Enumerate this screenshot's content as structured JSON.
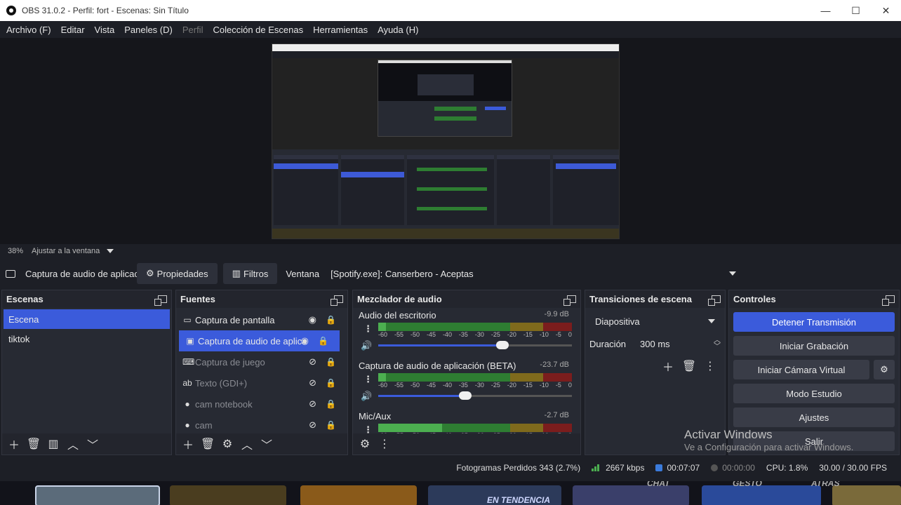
{
  "window": {
    "title": "OBS 31.0.2 - Perfil: fort - Escenas: Sin Título",
    "controls": [
      "—",
      "☐",
      "✕"
    ]
  },
  "menu": {
    "items": [
      {
        "label": "Archivo (F)",
        "disabled": false
      },
      {
        "label": "Editar",
        "disabled": false
      },
      {
        "label": "Vista",
        "disabled": false
      },
      {
        "label": "Paneles (D)",
        "disabled": false
      },
      {
        "label": "Perfil",
        "disabled": true
      },
      {
        "label": "Colección de Escenas",
        "disabled": false
      },
      {
        "label": "Herramientas",
        "disabled": false
      },
      {
        "label": "Ayuda (H)",
        "disabled": false
      }
    ]
  },
  "preview": {
    "zoom": "38%",
    "fit_label": "Ajustar a la ventana"
  },
  "source_toolbar": {
    "source_name": "Captura de audio de aplicación",
    "properties_label": "Propiedades",
    "filters_label": "Filtros",
    "window_label": "Ventana",
    "window_value": "[Spotify.exe]: Canserbero - Aceptas"
  },
  "scenes": {
    "title": "Escenas",
    "items": [
      {
        "label": "Escena",
        "selected": true
      },
      {
        "label": "tiktok",
        "selected": false
      }
    ]
  },
  "sources": {
    "title": "Fuentes",
    "items": [
      {
        "label": "Captura de pantalla",
        "icon": "monitor-icon",
        "visible": true,
        "selected": false
      },
      {
        "label": "Captura de audio de aplicación",
        "icon": "app-audio-icon",
        "visible": true,
        "selected": true
      },
      {
        "label": "Captura de juego",
        "icon": "gamepad-icon",
        "visible": false,
        "selected": false
      },
      {
        "label": "Texto (GDI+)",
        "icon": "text-icon",
        "visible": false,
        "selected": false
      },
      {
        "label": "cam notebook",
        "icon": "camera-icon",
        "visible": false,
        "selected": false
      },
      {
        "label": "cam",
        "icon": "camera-icon",
        "visible": false,
        "selected": false
      }
    ]
  },
  "mixer": {
    "title": "Mezclador de audio",
    "ticks": [
      "-60",
      "-55",
      "-50",
      "-45",
      "-40",
      "-35",
      "-30",
      "-25",
      "-20",
      "-15",
      "-10",
      "-5",
      "0"
    ],
    "channels": [
      {
        "name": "Audio del escritorio",
        "db": "-9.9 dB",
        "level": 0.04,
        "volume": 0.64
      },
      {
        "name": "Captura de audio de aplicación (BETA)",
        "db": "-23.7 dB",
        "level": 0.04,
        "volume": 0.45
      },
      {
        "name": "Mic/Aux",
        "db": "-2.7 dB",
        "level": 0.33,
        "volume": null
      }
    ]
  },
  "transitions": {
    "title": "Transiciones de escena",
    "selected": "Diapositiva",
    "duration_label": "Duración",
    "duration_value": "300 ms"
  },
  "controls": {
    "title": "Controles",
    "buttons": {
      "stop_stream": "Detener Transmisión",
      "start_record": "Iniciar Grabación",
      "virtual_cam": "Iniciar Cámara Virtual",
      "studio_mode": "Modo Estudio",
      "settings": "Ajustes",
      "exit": "Salir"
    }
  },
  "status": {
    "dropped_frames": "Fotogramas Perdidos 343 (2.7%)",
    "bitrate": "2667 kbps",
    "stream_time": "00:07:07",
    "record_time": "00:00:00",
    "cpu": "CPU: 1.8%",
    "fps": "30.00 / 30.00 FPS"
  },
  "watermark": {
    "line1": "Activar Windows",
    "line2": "Ve a Configuración para activar Windows."
  },
  "strip": {
    "labels": [
      "EN TENDENCIA",
      "CHAT",
      "GESTO",
      "ATRÁS"
    ]
  },
  "colors": {
    "accent": "#3b5bdb",
    "panel": "#272a33",
    "background": "#1d1f26"
  }
}
